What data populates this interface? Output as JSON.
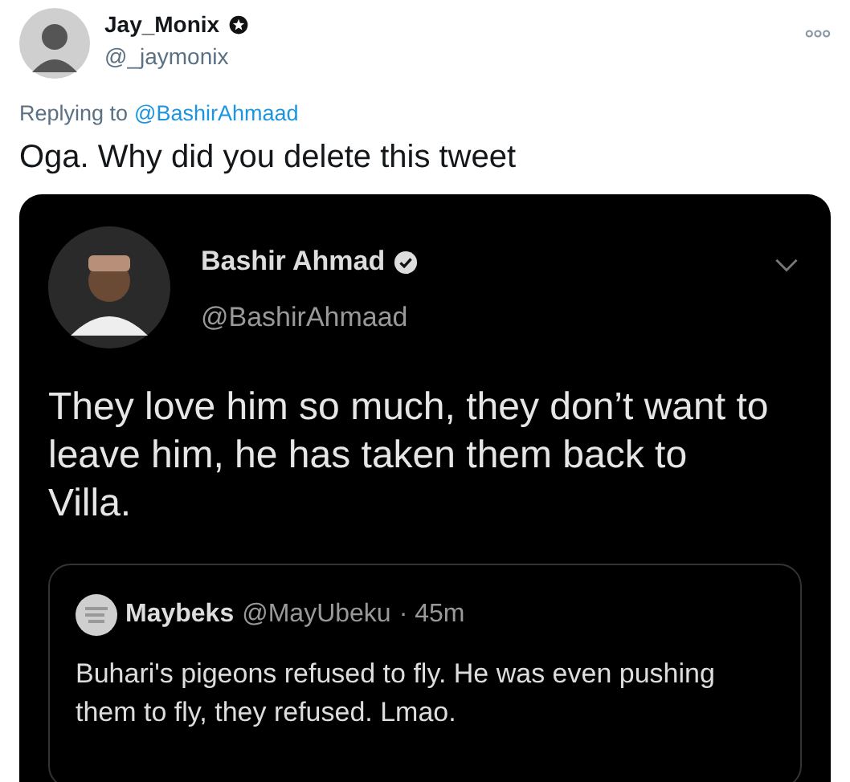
{
  "author": {
    "name": "Jay_Monix",
    "handle": "@_jaymonix",
    "verified": true
  },
  "reply": {
    "prefix": "Replying to",
    "mention": "@BashirAhmaad"
  },
  "text": "Oga. Why did you delete this tweet",
  "embedded_tweet": {
    "name": "Bashir Ahmad",
    "handle": "@BashirAhmaad",
    "verified": true,
    "text": "They love him so much, they don’t want to leave him, he has taken them back to Villa.",
    "quoted": {
      "name": "Maybeks",
      "handle": "@MayUbeku",
      "time": "· 45m",
      "text": "Buhari's pigeons refused to fly. He was even pushing them to fly, they refused. Lmao."
    }
  }
}
